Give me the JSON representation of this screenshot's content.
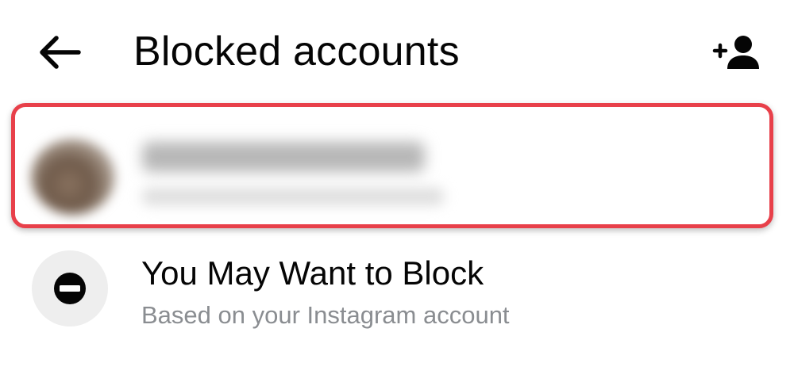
{
  "header": {
    "title": "Blocked accounts",
    "back_icon": "arrow-left-icon",
    "add_icon": "add-person-icon"
  },
  "blocked_list": {
    "highlight_color": "#e8404a"
  },
  "suggestion": {
    "title": "You May Want to Block",
    "subtitle": "Based on your Instagram account",
    "icon": "block-icon",
    "subtitle_color": "#8a8d91"
  }
}
